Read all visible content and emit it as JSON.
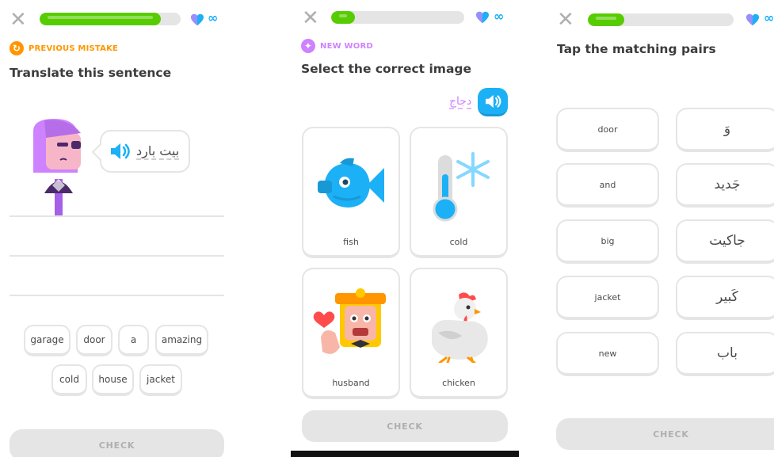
{
  "colors": {
    "green": "#58cc02",
    "blue": "#1cb0f6",
    "orange": "#ff9600",
    "purple": "#ce82ff",
    "gray": "#e5e5e5"
  },
  "panel1": {
    "progress": 0.86,
    "infinity": "∞",
    "tag": "PREVIOUS MISTAKE",
    "tag_icon": "refresh-icon",
    "title": "Translate this sentence",
    "prompt_text": "بيت بارد",
    "word_bank": [
      "garage",
      "door",
      "a",
      "amazing",
      "cold",
      "house",
      "jacket"
    ],
    "check_label": "CHECK"
  },
  "panel2": {
    "progress": 0.18,
    "infinity": "∞",
    "tag": "NEW WORD",
    "tag_icon": "sparkle-icon",
    "title": "Select the correct image",
    "word": "دجاج",
    "cards": [
      {
        "label": "fish",
        "icon": "fish-icon"
      },
      {
        "label": "cold",
        "icon": "thermometer-snowflake-icon"
      },
      {
        "label": "husband",
        "icon": "husband-character-icon"
      },
      {
        "label": "chicken",
        "icon": "chicken-icon"
      }
    ],
    "check_label": "CHECK"
  },
  "panel3": {
    "progress": 0.25,
    "infinity": "∞",
    "title": "Tap the matching pairs",
    "left": [
      "door",
      "and",
      "big",
      "jacket",
      "new"
    ],
    "right": [
      "وَ",
      "جَديد",
      "جاكيت",
      "كَبير",
      "باب"
    ],
    "check_label": "CHECK"
  }
}
